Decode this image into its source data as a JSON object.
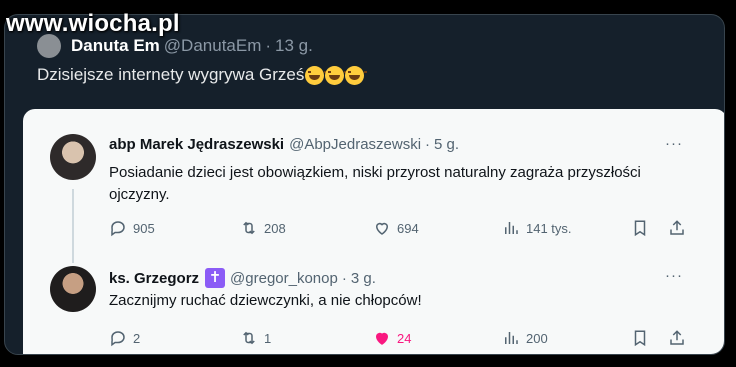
{
  "watermark": {
    "text": "www.wiocha.pl"
  },
  "outer": {
    "name": "Danuta Em",
    "handle": "@DanutaEm",
    "sep": "·",
    "time": "13 g.",
    "text": "Dzisiejsze internety wygrywa Grześ",
    "emoji": [
      "rofl-emoji",
      "joy-emoji",
      "rofl-emoji"
    ]
  },
  "tweets": [
    {
      "name": "abp Marek Jędraszewski",
      "handle": "@AbpJedraszewski",
      "sep": "·",
      "time": "5 g.",
      "more": "···",
      "text": "Posiadanie dzieci jest obowiązkiem, niski przyrost naturalny zagraża przyszłości ojczyzny.",
      "replies": "905",
      "retweets": "208",
      "likes": "694",
      "views": "141 tys."
    },
    {
      "name": "ks. Grzegorz",
      "badge": "✝",
      "handle": "@gregor_konop",
      "sep": "·",
      "time": "3 g.",
      "more": "···",
      "text": "Zacznijmy ruchać dziewczynki, a nie chłopców!",
      "replies": "2",
      "retweets": "1",
      "likes": "24",
      "views": "200",
      "liked": true
    }
  ],
  "colors": {
    "background": "#15202b",
    "card": "#f7f9f9",
    "like": "#f91880",
    "muted": "#536471"
  }
}
